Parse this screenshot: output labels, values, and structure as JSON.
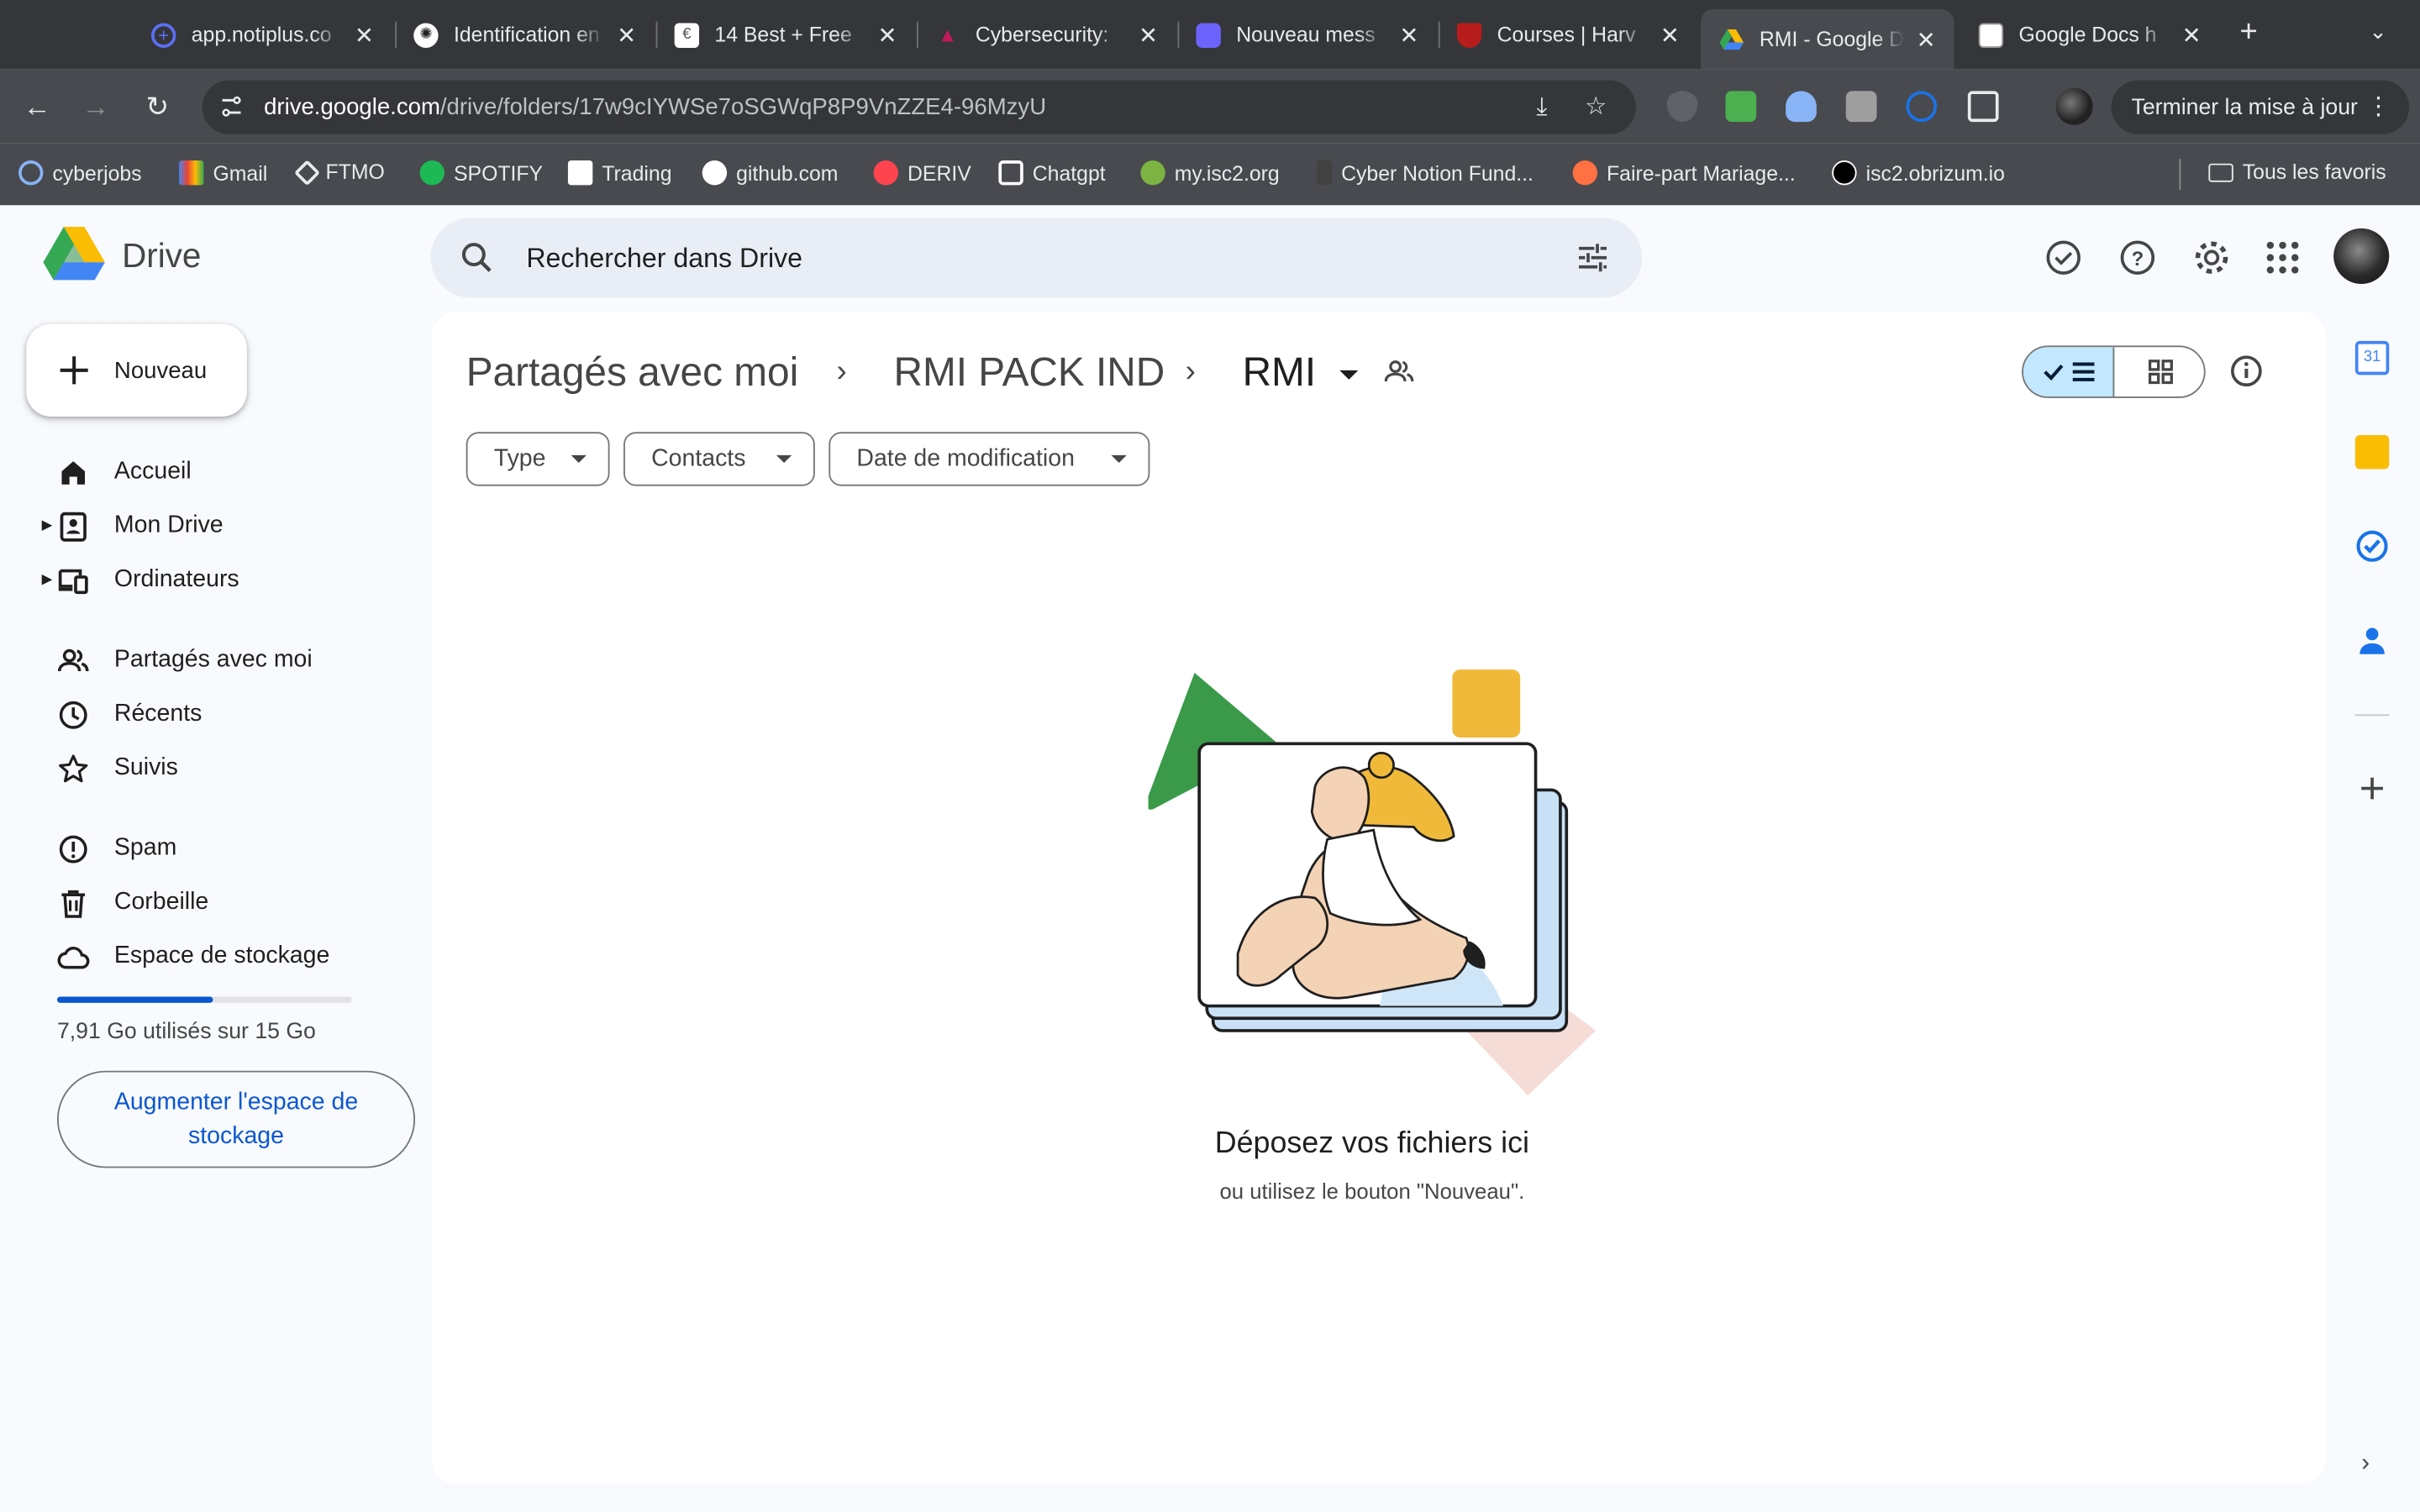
{
  "browser": {
    "tabs": [
      {
        "title": "app.notiplus.co",
        "favicon_color": "#5b6ef5",
        "active": false
      },
      {
        "title": "Identification en",
        "favicon_color": "#ffffff",
        "active": false
      },
      {
        "title": "14 Best + Free",
        "favicon_color": "#ffffff",
        "active": false
      },
      {
        "title": "Cybersecurity:",
        "favicon_color": "#c2185b",
        "active": false
      },
      {
        "title": "Nouveau mess",
        "favicon_color": "#6c63ff",
        "active": false
      },
      {
        "title": "Courses | Harv",
        "favicon_color": "#b71c1c",
        "active": false
      },
      {
        "title": "RMI - Google D",
        "favicon_color": "#34a853",
        "active": true
      },
      {
        "title": "Google Docs h",
        "favicon_color": "#ffffff",
        "active": false
      }
    ],
    "url_host": "drive.google.com",
    "url_path": "/drive/folders/17w9cIYWSe7oSGWqP8P9VnZZE4-96MzyU",
    "update_button": "Terminer la mise à jour",
    "bookmarks": [
      {
        "label": "cyberjobs",
        "color": "#8ab4f8"
      },
      {
        "label": "Gmail",
        "color": "#ea4335"
      },
      {
        "label": "FTMO",
        "color": "#e8eaed"
      },
      {
        "label": "SPOTIFY",
        "color": "#1db954"
      },
      {
        "label": "Trading",
        "color": "#ffffff"
      },
      {
        "label": "github.com",
        "color": "#ffffff"
      },
      {
        "label": "DERIV",
        "color": "#ff444f"
      },
      {
        "label": "Chatgpt",
        "color": "#ffffff"
      },
      {
        "label": "my.isc2.org",
        "color": "#7cb342"
      },
      {
        "label": "Cyber Notion Fund...",
        "color": "#424242"
      },
      {
        "label": "Faire-part Mariage...",
        "color": "#ff7043"
      },
      {
        "label": "isc2.obrizum.io",
        "color": "#000000"
      }
    ],
    "all_bookmarks": "Tous les favoris"
  },
  "drive": {
    "app_name": "Drive",
    "search_placeholder": "Rechercher dans Drive",
    "new_button": "Nouveau",
    "nav": [
      {
        "label": "Accueil",
        "icon": "home-icon",
        "expandable": false
      },
      {
        "label": "Mon Drive",
        "icon": "my-drive-icon",
        "expandable": true
      },
      {
        "label": "Ordinateurs",
        "icon": "computers-icon",
        "expandable": true
      },
      {
        "label": "Partagés avec moi",
        "icon": "shared-icon",
        "expandable": false
      },
      {
        "label": "Récents",
        "icon": "clock-icon",
        "expandable": false
      },
      {
        "label": "Suivis",
        "icon": "star-icon",
        "expandable": false
      },
      {
        "label": "Spam",
        "icon": "spam-icon",
        "expandable": false
      },
      {
        "label": "Corbeille",
        "icon": "trash-icon",
        "expandable": false
      },
      {
        "label": "Espace de stockage",
        "icon": "cloud-icon",
        "expandable": false
      }
    ],
    "storage": {
      "used_text": "7,91 Go utilisés sur 15 Go",
      "used_fraction": 0.527,
      "upgrade_button": "Augmenter l'espace de stockage"
    },
    "breadcrumb": [
      "Partagés avec moi",
      "RMI PACK IND",
      "RMI"
    ],
    "filters": [
      "Type",
      "Contacts",
      "Date de modification"
    ],
    "empty_state": {
      "title": "Déposez vos fichiers ici",
      "subtitle": "ou utilisez le bouton \"Nouveau\"."
    },
    "colors": {
      "accent": "#0b57d0",
      "selected_toggle": "#c2e7ff",
      "search_bg": "#e9eef6"
    }
  }
}
